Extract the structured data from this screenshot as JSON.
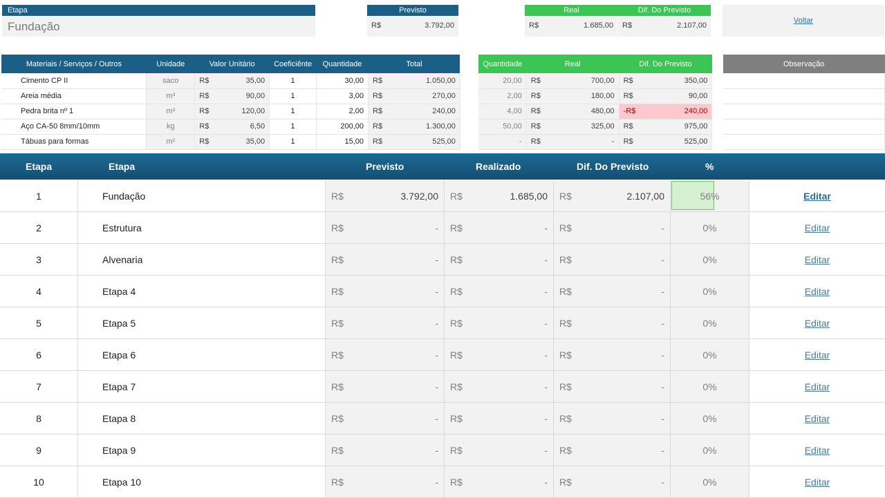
{
  "top": {
    "etapa_label": "Etapa",
    "etapa_value": "Fundação",
    "previsto_label": "Previsto",
    "previsto_currency": "R$",
    "previsto_value": "3.792,00",
    "real_label": "Real",
    "real_currency": "R$",
    "real_value": "1.685,00",
    "dif_label": "Dif. Do Previsto",
    "dif_currency": "R$",
    "dif_value": "2.107,00",
    "voltar_label": "Voltar"
  },
  "detail": {
    "headers": {
      "materiais": "Materiais / Serviços / Outros",
      "unidade": "Unidade",
      "valor_unitario": "Valor Unitário",
      "coeficiente": "Coeficiênte",
      "quantidade": "Quantidade",
      "total": "Total",
      "real_quantidade": "Quantidade",
      "real": "Real",
      "dif": "Dif. Do Previsto",
      "observacao": "Observação"
    },
    "rows": [
      {
        "material": "Cimento CP II",
        "unidade": "saco",
        "vu_cur": "R$",
        "vu": "35,00",
        "coef": "1",
        "qtd": "30,00",
        "tot_cur": "R$",
        "total": "1.050,00",
        "rq": "20,00",
        "real_cur": "R$",
        "real": "700,00",
        "dif_cur": "R$",
        "dif": "350,00"
      },
      {
        "material": "Areia média",
        "unidade": "m³",
        "vu_cur": "R$",
        "vu": "90,00",
        "coef": "1",
        "qtd": "3,00",
        "tot_cur": "R$",
        "total": "270,00",
        "rq": "2,00",
        "real_cur": "R$",
        "real": "180,00",
        "dif_cur": "R$",
        "dif": "90,00"
      },
      {
        "material": "Pedra brita nº 1",
        "unidade": "m³",
        "vu_cur": "R$",
        "vu": "120,00",
        "coef": "1",
        "qtd": "2,00",
        "tot_cur": "R$",
        "total": "240,00",
        "rq": "4,00",
        "real_cur": "R$",
        "real": "480,00",
        "dif_cur": "-R$",
        "dif": "240,00",
        "negative": true
      },
      {
        "material": "Aço CA-50 8mm/10mm",
        "unidade": "kg",
        "vu_cur": "R$",
        "vu": "6,50",
        "coef": "1",
        "qtd": "200,00",
        "tot_cur": "R$",
        "total": "1.300,00",
        "rq": "50,00",
        "real_cur": "R$",
        "real": "325,00",
        "dif_cur": "R$",
        "dif": "975,00"
      },
      {
        "material": "Tábuas para formas",
        "unidade": "m²",
        "vu_cur": "R$",
        "vu": "35,00",
        "coef": "1",
        "qtd": "15,00",
        "tot_cur": "R$",
        "total": "525,00",
        "rq": "-",
        "real_cur": "R$",
        "real": "-",
        "dif_cur": "R$",
        "dif": "525,00"
      }
    ]
  },
  "stages": {
    "headers": {
      "etapa_num": "Etapa",
      "etapa_name": "Etapa",
      "previsto": "Previsto",
      "realizado": "Realizado",
      "dif": "Dif. Do Previsto",
      "pct": "%"
    },
    "currency": "R$",
    "edit_label": "Editar",
    "rows": [
      {
        "num": "1",
        "name": "Fundação",
        "previsto": "3.792,00",
        "realizado": "1.685,00",
        "dif": "2.107,00",
        "pct": "56%",
        "pct_value": 0.56
      },
      {
        "num": "2",
        "name": "Estrutura",
        "previsto": "-",
        "realizado": "-",
        "dif": "-",
        "pct": "0%",
        "pct_value": 0
      },
      {
        "num": "3",
        "name": "Alvenaria",
        "previsto": "-",
        "realizado": "-",
        "dif": "-",
        "pct": "0%",
        "pct_value": 0
      },
      {
        "num": "4",
        "name": "Etapa 4",
        "previsto": "-",
        "realizado": "-",
        "dif": "-",
        "pct": "0%",
        "pct_value": 0
      },
      {
        "num": "5",
        "name": "Etapa 5",
        "previsto": "-",
        "realizado": "-",
        "dif": "-",
        "pct": "0%",
        "pct_value": 0
      },
      {
        "num": "6",
        "name": "Etapa 6",
        "previsto": "-",
        "realizado": "-",
        "dif": "-",
        "pct": "0%",
        "pct_value": 0
      },
      {
        "num": "7",
        "name": "Etapa 7",
        "previsto": "-",
        "realizado": "-",
        "dif": "-",
        "pct": "0%",
        "pct_value": 0
      },
      {
        "num": "8",
        "name": "Etapa 8",
        "previsto": "-",
        "realizado": "-",
        "dif": "-",
        "pct": "0%",
        "pct_value": 0
      },
      {
        "num": "9",
        "name": "Etapa 9",
        "previsto": "-",
        "realizado": "-",
        "dif": "-",
        "pct": "0%",
        "pct_value": 0
      },
      {
        "num": "10",
        "name": "Etapa 10",
        "previsto": "-",
        "realizado": "-",
        "dif": "-",
        "pct": "0%",
        "pct_value": 0
      }
    ]
  },
  "colors": {
    "header_blue": "#1c5f86",
    "header_green": "#3cc455",
    "header_gray": "#7f7f7f",
    "negative_fill": "#ffc7ce",
    "progress_fill": "#d5f0d0"
  }
}
